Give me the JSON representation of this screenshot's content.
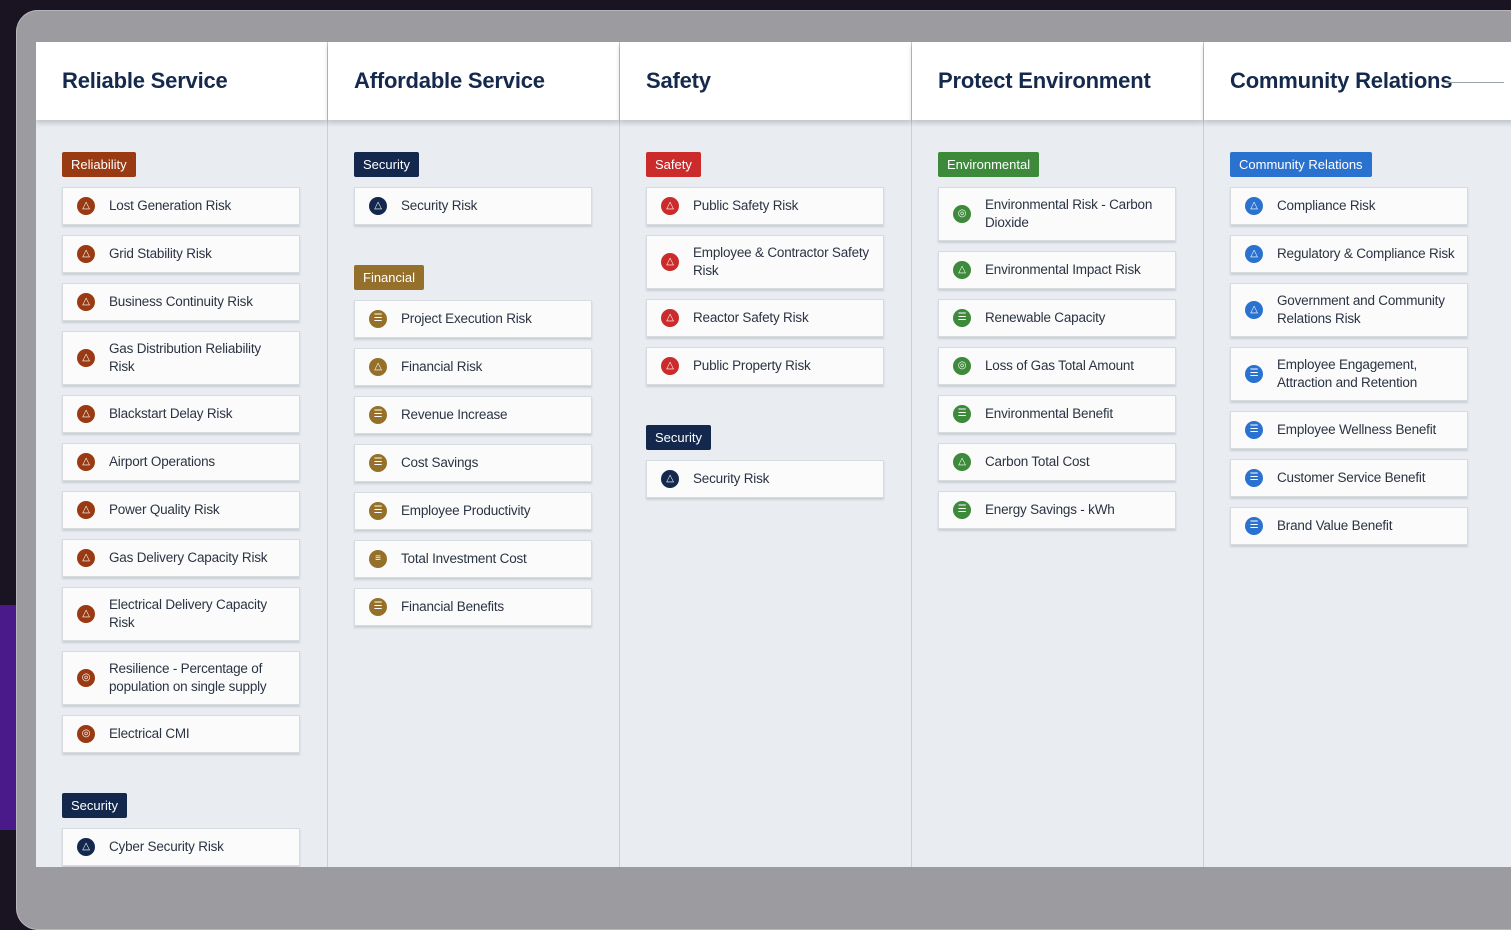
{
  "colors": {
    "reliability": "#9a3a12",
    "security": "#14284d",
    "financial": "#94702a",
    "safety": "#cc2b2b",
    "environmental": "#3c8a3a",
    "community": "#2a72cf",
    "header_text": "#15294d"
  },
  "columns": [
    {
      "title": "Reliable Service",
      "categories": [
        {
          "label": "Reliability",
          "color": "#9a3a12",
          "items": [
            {
              "label": "Lost Generation Risk",
              "icon": "warning-triangle-icon"
            },
            {
              "label": "Grid Stability Risk",
              "icon": "warning-triangle-icon"
            },
            {
              "label": "Business Continuity Risk",
              "icon": "warning-triangle-icon"
            },
            {
              "label": "Gas Distribution Reliability Risk",
              "icon": "warning-triangle-icon"
            },
            {
              "label": "Blackstart Delay Risk",
              "icon": "warning-triangle-icon"
            },
            {
              "label": "Airport Operations",
              "icon": "warning-triangle-icon"
            },
            {
              "label": "Power Quality Risk",
              "icon": "warning-triangle-icon"
            },
            {
              "label": "Gas Delivery Capacity Risk",
              "icon": "warning-triangle-icon"
            },
            {
              "label": "Electrical Delivery Capacity Risk",
              "icon": "warning-triangle-icon"
            },
            {
              "label": "Resilience - Percentage of population on single supply",
              "icon": "gauge-icon"
            },
            {
              "label": "Electrical CMI",
              "icon": "gauge-icon"
            }
          ]
        },
        {
          "label": "Security",
          "color": "#14284d",
          "items": [
            {
              "label": "Cyber Security Risk",
              "icon": "warning-triangle-icon"
            }
          ]
        }
      ]
    },
    {
      "title": "Affordable Service",
      "categories": [
        {
          "label": "Security",
          "color": "#14284d",
          "items": [
            {
              "label": "Security Risk",
              "icon": "warning-triangle-icon"
            }
          ]
        },
        {
          "label": "Financial",
          "color": "#94702a",
          "items": [
            {
              "label": "Project Execution Risk",
              "icon": "benefit-icon"
            },
            {
              "label": "Financial Risk",
              "icon": "warning-triangle-icon"
            },
            {
              "label": "Revenue Increase",
              "icon": "benefit-icon"
            },
            {
              "label": "Cost Savings",
              "icon": "benefit-icon"
            },
            {
              "label": "Employee Productivity",
              "icon": "benefit-icon"
            },
            {
              "label": "Total Investment Cost",
              "icon": "cost-icon"
            },
            {
              "label": "Financial Benefits",
              "icon": "benefit-icon"
            }
          ]
        }
      ]
    },
    {
      "title": "Safety",
      "categories": [
        {
          "label": "Safety",
          "color": "#cc2b2b",
          "items": [
            {
              "label": "Public Safety Risk",
              "icon": "warning-triangle-icon"
            },
            {
              "label": "Employee & Contractor Safety Risk",
              "icon": "warning-triangle-icon"
            },
            {
              "label": "Reactor Safety Risk",
              "icon": "warning-triangle-icon"
            },
            {
              "label": "Public Property Risk",
              "icon": "warning-triangle-icon"
            }
          ]
        },
        {
          "label": "Security",
          "color": "#14284d",
          "items": [
            {
              "label": "Security Risk",
              "icon": "warning-triangle-icon"
            }
          ]
        }
      ]
    },
    {
      "title": "Protect Environment",
      "categories": [
        {
          "label": "Environmental",
          "color": "#3c8a3a",
          "items": [
            {
              "label": "Environmental Risk - Carbon Dioxide",
              "icon": "gauge-icon"
            },
            {
              "label": "Environmental Impact Risk",
              "icon": "warning-triangle-icon"
            },
            {
              "label": "Renewable Capacity",
              "icon": "benefit-icon"
            },
            {
              "label": "Loss of Gas Total Amount",
              "icon": "gauge-icon"
            },
            {
              "label": "Environmental Benefit",
              "icon": "benefit-icon"
            },
            {
              "label": "Carbon Total Cost",
              "icon": "warning-triangle-icon"
            },
            {
              "label": "Energy Savings - kWh",
              "icon": "benefit-icon"
            }
          ]
        }
      ]
    },
    {
      "title": "Community Relations",
      "categories": [
        {
          "label": "Community Relations",
          "color": "#2a72cf",
          "items": [
            {
              "label": "Compliance Risk",
              "icon": "warning-triangle-icon"
            },
            {
              "label": "Regulatory & Compliance Risk",
              "icon": "warning-triangle-icon"
            },
            {
              "label": "Government and Community Relations Risk",
              "icon": "warning-triangle-icon"
            },
            {
              "label": "Employee Engagement, Attraction and Retention",
              "icon": "benefit-icon"
            },
            {
              "label": "Employee Wellness Benefit",
              "icon": "benefit-icon"
            },
            {
              "label": "Customer Service Benefit",
              "icon": "benefit-icon"
            },
            {
              "label": "Brand Value Benefit",
              "icon": "benefit-icon"
            }
          ]
        }
      ]
    }
  ]
}
